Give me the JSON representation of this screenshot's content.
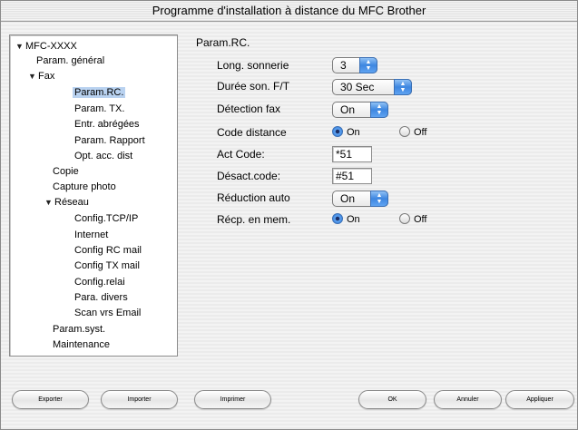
{
  "window": {
    "title": "Programme d'installation à distance du MFC Brother"
  },
  "tree": {
    "items": [
      {
        "label": "MFC-XXXX",
        "expanded": true
      },
      {
        "label": "Param. général"
      },
      {
        "label": "Fax",
        "expanded": true
      },
      {
        "label": "Param.RC.",
        "selected": true
      },
      {
        "label": "Param. TX."
      },
      {
        "label": "Entr. abrégées"
      },
      {
        "label": "Param. Rapport"
      },
      {
        "label": "Opt. acc. dist"
      },
      {
        "label": "Copie"
      },
      {
        "label": "Capture photo"
      },
      {
        "label": "Réseau",
        "expanded": true
      },
      {
        "label": "Config.TCP/IP"
      },
      {
        "label": "Internet"
      },
      {
        "label": "Config RC mail"
      },
      {
        "label": "Config TX mail"
      },
      {
        "label": "Config.relai"
      },
      {
        "label": "Para. divers"
      },
      {
        "label": "Scan vrs Email"
      },
      {
        "label": "Param.syst."
      },
      {
        "label": "Maintenance"
      }
    ],
    "expand_glyph": "▼"
  },
  "panel": {
    "title": "Param.RC.",
    "long_sonnerie": {
      "label": "Long. sonnerie",
      "value": "3"
    },
    "duree_son": {
      "label": "Durée son. F/T",
      "value": "30 Sec"
    },
    "detection_fax": {
      "label": "Détection fax",
      "value": "On"
    },
    "code_distance": {
      "label": "Code distance",
      "on": "On",
      "off": "Off",
      "selected": "On"
    },
    "act_code": {
      "label": "Act Code:",
      "value": "*51"
    },
    "desact_code": {
      "label": "Désact.code:",
      "value": "#51"
    },
    "reduction_auto": {
      "label": "Réduction auto",
      "value": "On"
    },
    "recp_mem": {
      "label": "Récp. en mem.",
      "on": "On",
      "off": "Off",
      "selected": "On"
    }
  },
  "buttons": {
    "exporter": "Exporter",
    "importer": "Importer",
    "imprimer": "Imprimer",
    "ok": "OK",
    "annuler": "Annuler",
    "appliquer": "Appliquer"
  },
  "popup_arrow_icon": "up-down-arrows-icon",
  "accent_color": "#3d86e0"
}
